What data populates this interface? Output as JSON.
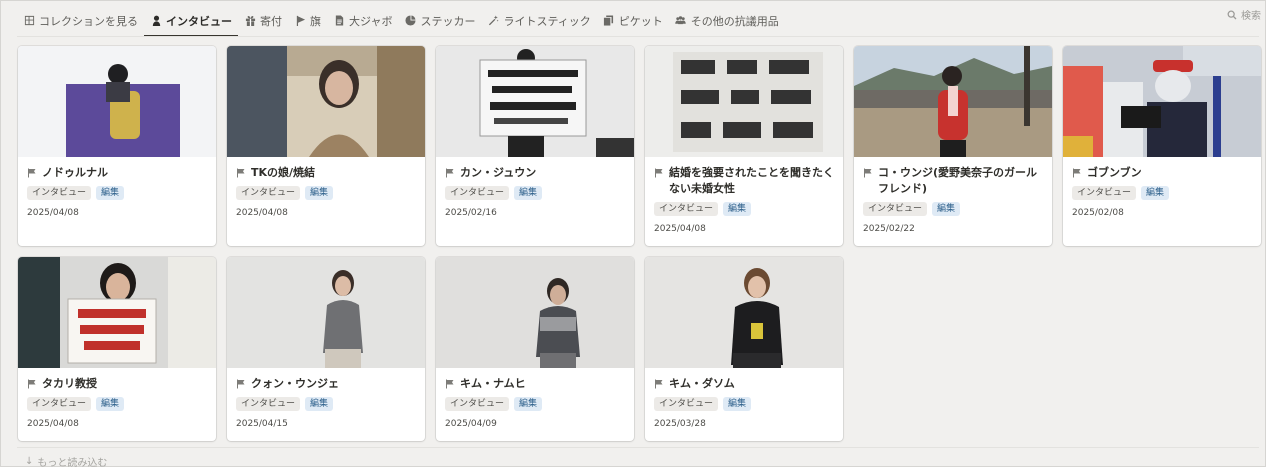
{
  "tabs": [
    {
      "label": "コレクションを見る",
      "icon": "table-icon",
      "active": false
    },
    {
      "label": "インタビュー",
      "icon": "person-icon",
      "active": true
    },
    {
      "label": "寄付",
      "icon": "gift-icon",
      "active": false
    },
    {
      "label": "旗",
      "icon": "flag-icon",
      "active": false
    },
    {
      "label": "大ジャボ",
      "icon": "document-icon",
      "active": false
    },
    {
      "label": "ステッカー",
      "icon": "sticker-icon",
      "active": false
    },
    {
      "label": "ライトスティック",
      "icon": "wand-icon",
      "active": false
    },
    {
      "label": "ピケット",
      "icon": "copy-icon",
      "active": false
    },
    {
      "label": "その他の抗議用品",
      "icon": "people-icon",
      "active": false
    }
  ],
  "search": {
    "label": "検索",
    "icon": "search-icon"
  },
  "cards": [
    {
      "title": "ノドゥルナル",
      "tags": [
        "インタビュー",
        "編集"
      ],
      "date": "2025/04/08",
      "image": "person holding purple banner"
    },
    {
      "title": "TKの娘/焼結",
      "tags": [
        "インタビュー",
        "編集"
      ],
      "date": "2025/04/08",
      "image": "person in cafe"
    },
    {
      "title": "カン・ジュウン",
      "tags": [
        "インタビュー",
        "編集"
      ],
      "date": "2025/02/16",
      "image": "person holding sign"
    },
    {
      "title": "結婚を強要されたことを聞きたくない未婚女性",
      "tags": [
        "インタビュー",
        "編集"
      ],
      "date": "2025/04/08",
      "image": "handwritten cloth banner"
    },
    {
      "title": "コ・ウンジ(愛野美奈子のガールフレンド)",
      "tags": [
        "インタビュー",
        "編集"
      ],
      "date": "2025/02/22",
      "image": "person in red coat outdoors"
    },
    {
      "title": "ゴブンブン",
      "tags": [
        "インタビュー",
        "編集"
      ],
      "date": "2025/02/08",
      "image": "person speaking into microphones"
    },
    {
      "title": "タカリ教授",
      "tags": [
        "インタビュー",
        "編集"
      ],
      "date": "2025/04/08",
      "image": "person holding placard"
    },
    {
      "title": "クォン・ウンジェ",
      "tags": [
        "インタビュー",
        "編集"
      ],
      "date": "2025/04/15",
      "image": "seated person"
    },
    {
      "title": "キム・ナムヒ",
      "tags": [
        "インタビュー",
        "編集"
      ],
      "date": "2025/04/09",
      "image": "seated person"
    },
    {
      "title": "キム・ダソム",
      "tags": [
        "インタビュー",
        "編集"
      ],
      "date": "2025/03/28",
      "image": "seated person"
    }
  ],
  "load_more": {
    "label": "もっと読み込む",
    "icon": "arrow-down-icon"
  },
  "colors": {
    "background": "#f1f0ee",
    "card": "#ffffff",
    "tag_gray": "#eceae7",
    "tag_blue": "#dfeaf5"
  }
}
